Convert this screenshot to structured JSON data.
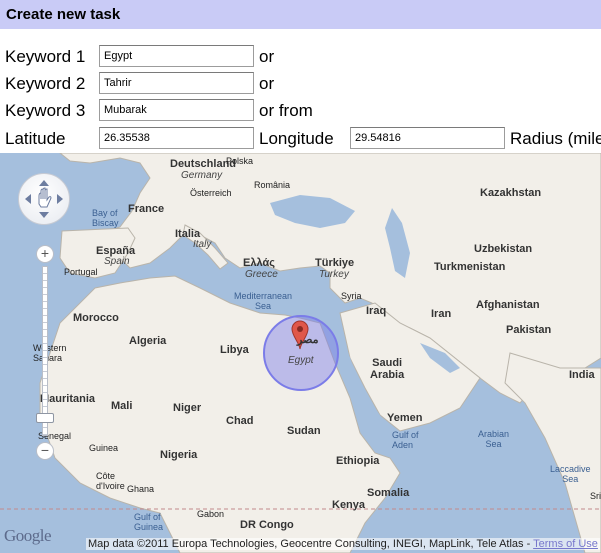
{
  "header": {
    "title": "Create new task"
  },
  "form": {
    "keyword1": {
      "label": "Keyword 1",
      "value": "Egypt",
      "suffix": "or"
    },
    "keyword2": {
      "label": "Keyword 2",
      "value": "Tahrir",
      "suffix": "or"
    },
    "keyword3": {
      "label": "Keyword 3",
      "value": "Mubarak",
      "suffix": "or from"
    },
    "latitude": {
      "label": "Latitude",
      "value": "26.35538"
    },
    "longitude": {
      "label": "Longitude",
      "value": "29.54816"
    },
    "radius": {
      "label": "Radius (mile"
    }
  },
  "map": {
    "colors": {
      "water": "#a5bfdd",
      "land": "#f2efe9",
      "circle": "#7b7ce8",
      "marker": "#e0574a"
    },
    "labels": {
      "germany": "Deutschland",
      "poland": "Polska",
      "germany_en": "Germany",
      "austria": "Österreich",
      "france": "France",
      "romania": "România",
      "italia": "Italia",
      "italy": "Italy",
      "kazakhstan": "Kazakhstan",
      "bay_of_biscay": "Bay of\nBiscay",
      "espana": "España",
      "spain": "Spain",
      "portugal": "Portugal",
      "ellas": "Ελλάς",
      "greece": "Greece",
      "turkiye": "Türkiye",
      "turkey": "Turkey",
      "uzbekistan": "Uzbekistan",
      "turkmenistan": "Turkmenistan",
      "mediterranean": "Mediterranean\nSea",
      "syria": "Syria",
      "afghanistan": "Afghanistan",
      "morocco": "Morocco",
      "iraq": "Iraq",
      "iran": "Iran",
      "pakistan": "Pakistan",
      "algeria": "Algeria",
      "libya": "Libya",
      "egypt_ar": "مصر",
      "egypt": "Egypt",
      "western_sahara": "Western\nSahara",
      "saudi_arabia": "Saudi\nArabia",
      "india": "India",
      "mauritania": "Mauritania",
      "mali": "Mali",
      "niger": "Niger",
      "chad": "Chad",
      "sudan": "Sudan",
      "yemen": "Yemen",
      "gulf_of_aden": "Gulf of\nAden",
      "senegal": "Senegal",
      "guinea": "Guinea",
      "nigeria": "Nigeria",
      "ethiopia": "Ethiopia",
      "somalia": "Somalia",
      "arabian_sea": "Arabian\nSea",
      "laccadive_sea": "Laccadive\nSea",
      "cote_divoire": "Côte\nd'Ivoire",
      "ghana": "Ghana",
      "gulf_of_guinea": "Gulf of\nGuinea",
      "kenya": "Kenya",
      "gabon": "Gabon",
      "dr_congo": "DR Congo",
      "sri": "Sri"
    },
    "attribution": "Map data ©2011 Europa Technologies, Geocentre Consulting, INEGI, MapLink, Tele Atlas -",
    "terms_link": "Terms of Use",
    "logo": "Google",
    "controls": {
      "zoom_in": "+",
      "zoom_out": "−"
    },
    "zoom_level_fraction": 0.9
  }
}
